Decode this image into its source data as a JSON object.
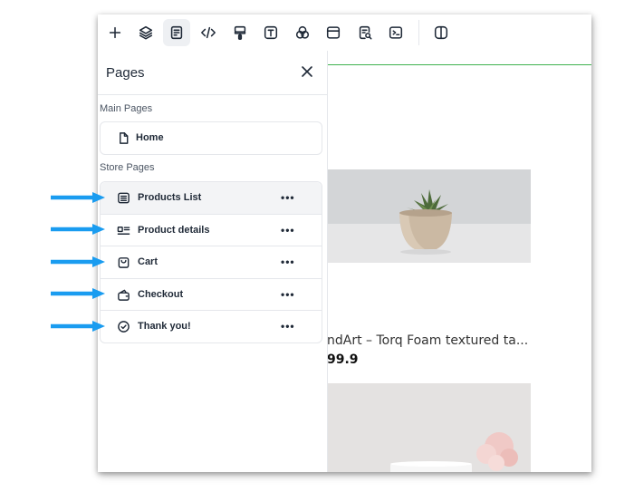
{
  "toolbar": {
    "buttons": [
      {
        "name": "add-icon"
      },
      {
        "name": "layers-icon"
      },
      {
        "name": "pages-icon",
        "active": true
      },
      {
        "name": "code-icon"
      },
      {
        "name": "paint-brush-icon"
      },
      {
        "name": "text-icon"
      },
      {
        "name": "shapes-icon"
      },
      {
        "name": "layout-icon"
      },
      {
        "name": "page-search-icon"
      },
      {
        "name": "terminal-icon"
      },
      {
        "name": "split-view-icon"
      }
    ]
  },
  "panel": {
    "title": "Pages",
    "close_icon": "close-icon",
    "main_pages_label": "Main Pages",
    "main_pages": [
      {
        "label": "Home",
        "icon": "page-icon"
      }
    ],
    "store_pages_label": "Store Pages",
    "store_pages": [
      {
        "label": "Products List",
        "icon": "list-icon",
        "more": "•••",
        "selected": true
      },
      {
        "label": "Product details",
        "icon": "details-icon",
        "more": "•••"
      },
      {
        "label": "Cart",
        "icon": "bag-icon",
        "more": "•••"
      },
      {
        "label": "Checkout",
        "icon": "wallet-icon",
        "more": "•••"
      },
      {
        "label": "Thank you!",
        "icon": "check-circle-icon",
        "more": "•••"
      }
    ]
  },
  "canvas": {
    "product_title": "ndArt – Torq Foam textured ta...",
    "product_price": "99.9"
  },
  "colors": {
    "arrow": "#1a9cf0",
    "green_line": "#3fb24f"
  }
}
